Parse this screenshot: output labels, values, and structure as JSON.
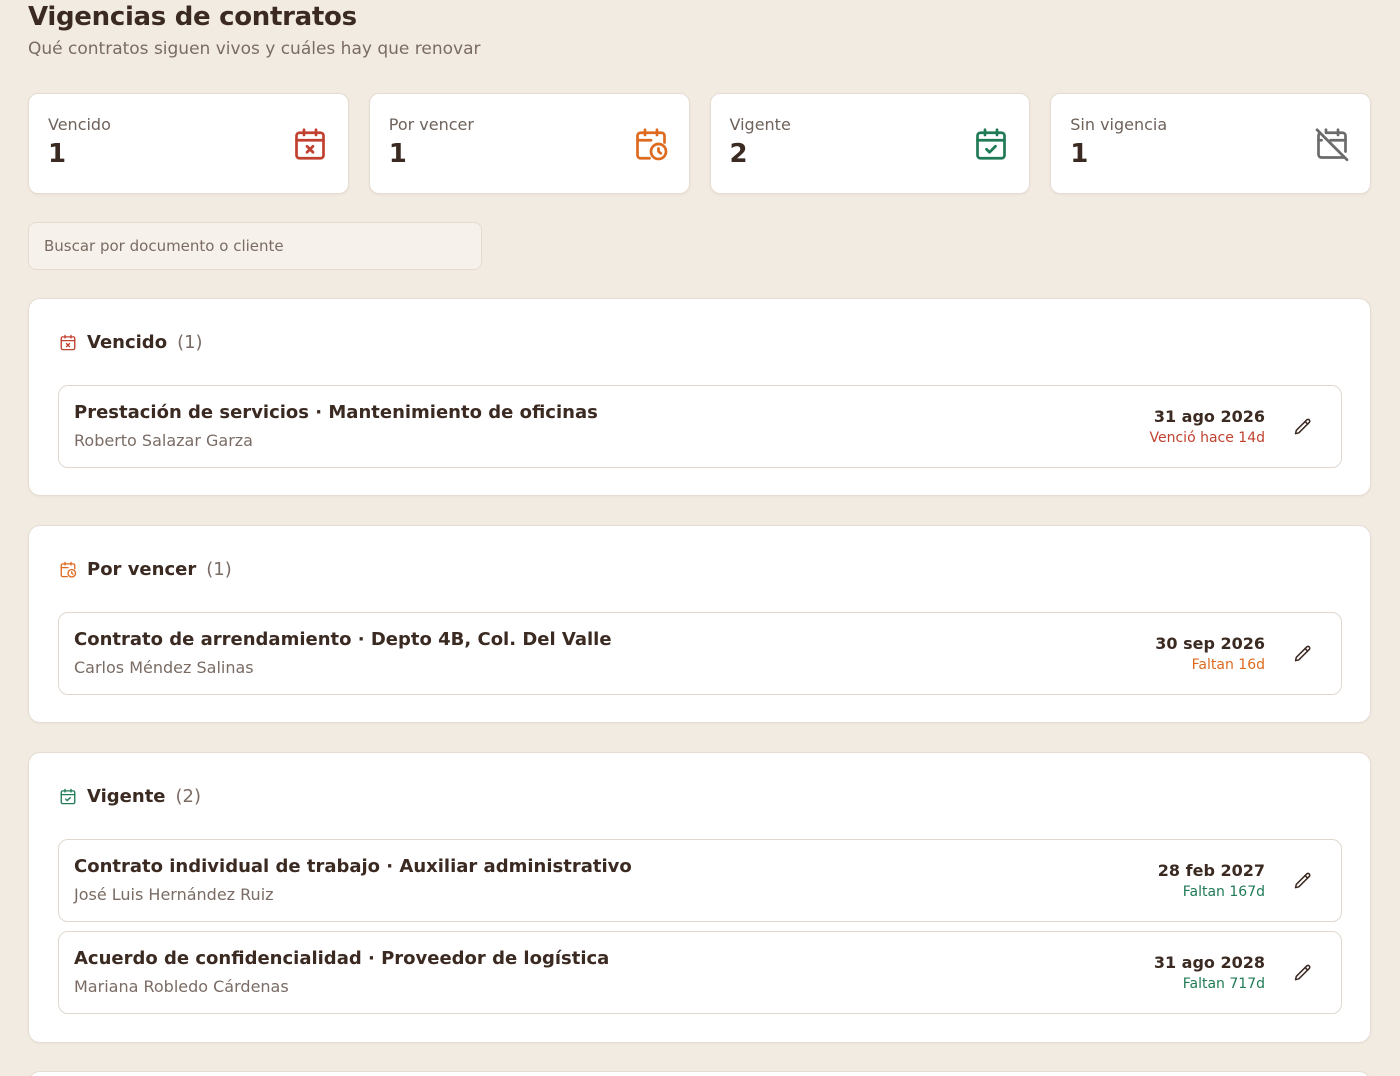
{
  "header": {
    "title": "Vigencias de contratos",
    "subtitle": "Qué contratos siguen vivos y cuáles hay que renovar"
  },
  "colors": {
    "vencido": "#c0412f",
    "por_vencer": "#dd6a1f",
    "vigente": "#1f7a55",
    "sin_vigencia": "#6b6b6b"
  },
  "stats": [
    {
      "label": "Vencido",
      "count": "1",
      "icon": "calendar-x-icon"
    },
    {
      "label": "Por vencer",
      "count": "1",
      "icon": "calendar-clock-icon"
    },
    {
      "label": "Vigente",
      "count": "2",
      "icon": "calendar-check-icon"
    },
    {
      "label": "Sin vigencia",
      "count": "1",
      "icon": "calendar-off-icon"
    }
  ],
  "search": {
    "placeholder": "Buscar por documento o cliente"
  },
  "sections": [
    {
      "name": "Vencido",
      "count": "(1)",
      "rows": [
        {
          "document": "Prestación de servicios · Mantenimiento de oficinas",
          "client": "Roberto Salazar Garza",
          "date": "31 ago 2026",
          "relative": "Venció hace 14d"
        }
      ]
    },
    {
      "name": "Por vencer",
      "count": "(1)",
      "rows": [
        {
          "document": "Contrato de arrendamiento · Depto 4B, Col. Del Valle",
          "client": "Carlos Méndez Salinas",
          "date": "30 sep 2026",
          "relative": "Faltan 16d"
        }
      ]
    },
    {
      "name": "Vigente",
      "count": "(2)",
      "rows": [
        {
          "document": "Contrato individual de trabajo · Auxiliar administrativo",
          "client": "José Luis Hernández Ruiz",
          "date": "28 feb 2027",
          "relative": "Faltan 167d"
        },
        {
          "document": "Acuerdo de confidencialidad · Proveedor de logística",
          "client": "Mariana Robledo Cárdenas",
          "date": "31 ago 2028",
          "relative": "Faltan 717d"
        }
      ]
    }
  ]
}
